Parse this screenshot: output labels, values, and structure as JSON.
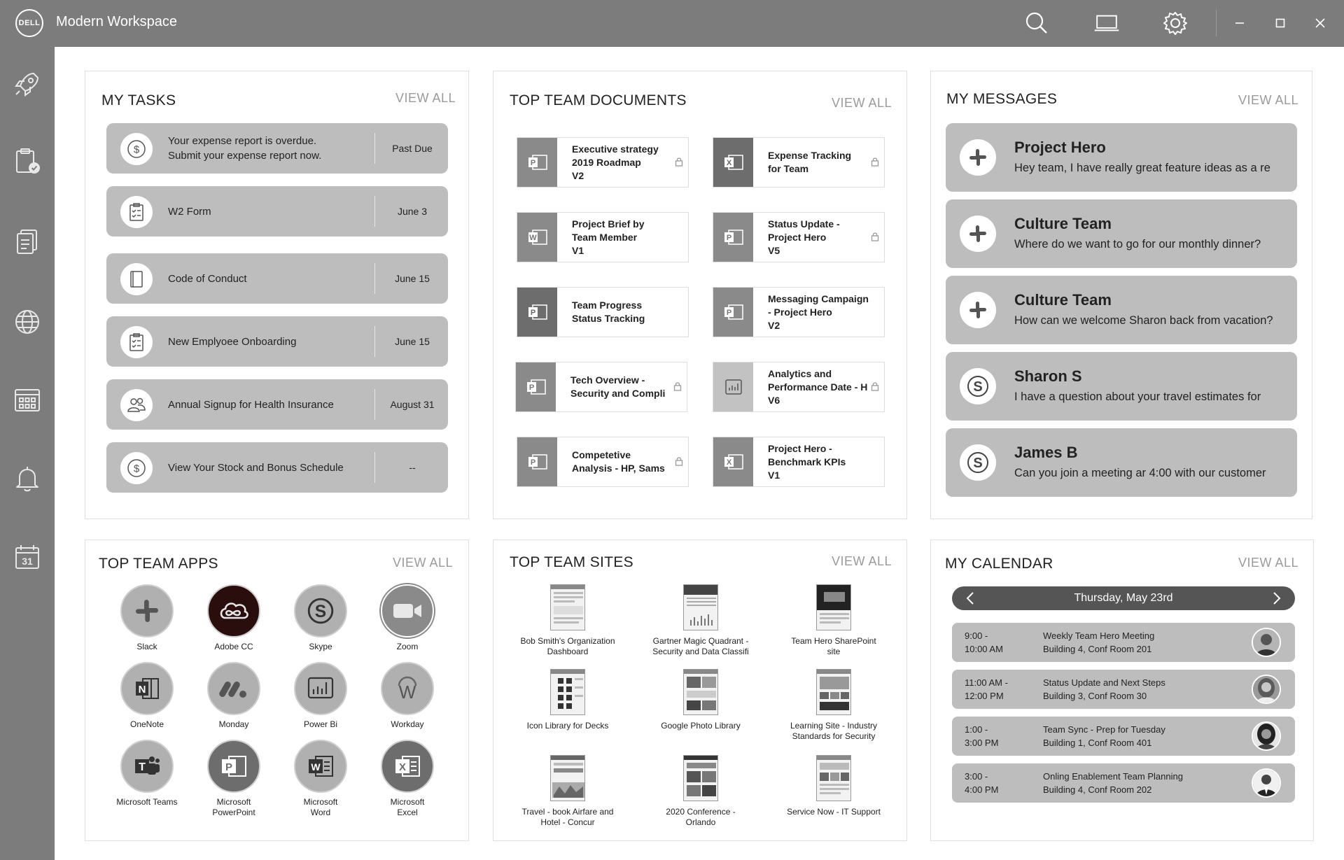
{
  "app": {
    "title": "Modern Workspace",
    "logo_text": "DELL"
  },
  "titlebar_icons": [
    "search-icon",
    "laptop-icon",
    "settings-icon",
    "minimize-icon",
    "maximize-icon",
    "close-icon"
  ],
  "sidebar_icons": [
    "rocket-icon",
    "clipboard-check-icon",
    "documents-icon",
    "globe-icon",
    "grid-calendar-icon",
    "bell-icon",
    "calendar-31-icon"
  ],
  "sidebar_calendar_day": "31",
  "tasks": {
    "title": "MY TASKS",
    "view_all": "VIEW ALL",
    "items": [
      {
        "text": "Your expense report is overdue.\nSubmit your expense report now.",
        "date": "Past Due",
        "icon": "dollar-icon"
      },
      {
        "text": "W2 Form",
        "date": "June 3",
        "icon": "checklist-icon"
      },
      {
        "text": "Code of Conduct",
        "date": "June 15",
        "icon": "book-icon"
      },
      {
        "text": "New Emplyoee Onboarding",
        "date": "June 15",
        "icon": "checklist-icon"
      },
      {
        "text": "Annual Signup for Health Insurance",
        "date": "August 31",
        "icon": "people-icon"
      },
      {
        "text": "View Your Stock and Bonus Schedule",
        "date": "--",
        "icon": "dollar-icon"
      }
    ]
  },
  "documents": {
    "title": "TOP TEAM DOCUMENTS",
    "view_all": "VIEW ALL",
    "items": [
      {
        "text": "Executive strategy\n2019 Roadmap\nV2",
        "type": "powerpoint",
        "locked": true
      },
      {
        "text": "Expense Tracking\nfor Team",
        "type": "excel",
        "locked": true
      },
      {
        "text": "Project Brief by\nTeam Member\nV1",
        "type": "word",
        "locked": false
      },
      {
        "text": "Status Update -\nProject Hero\nV5",
        "type": "powerpoint",
        "locked": true
      },
      {
        "text": "Team Progress\nStatus Tracking",
        "type": "powerpoint",
        "locked": false
      },
      {
        "text": "Messaging Campaign\n- Project Hero\nV2",
        "type": "powerpoint",
        "locked": false
      },
      {
        "text": "Tech Overview -\nSecurity and Compli",
        "type": "powerpoint",
        "locked": true
      },
      {
        "text": "Analytics and\nPerformance Date - H\nV6",
        "type": "powerbi",
        "locked": true
      },
      {
        "text": "Competetive\nAnalysis - HP, Sams",
        "type": "powerpoint",
        "locked": true
      },
      {
        "text": "Project Hero -\nBenchmark KPIs\nV1",
        "type": "excel",
        "locked": false
      }
    ]
  },
  "messages": {
    "title": "MY MESSAGES",
    "view_all": "VIEW ALL",
    "items": [
      {
        "name": "Project Hero",
        "body": "Hey team, I have really great feature ideas as a re",
        "icon": "slack-icon"
      },
      {
        "name": "Culture Team",
        "body": "Where do we want to go for our monthly dinner?",
        "icon": "slack-icon"
      },
      {
        "name": "Culture Team",
        "body": "How can we welcome Sharon back from vacation?",
        "icon": "slack-icon"
      },
      {
        "name": "Sharon S",
        "body": "I have a question about your travel estimates for",
        "icon": "skype-icon"
      },
      {
        "name": "James B",
        "body": "Can you join a meeting ar 4:00 with our customer",
        "icon": "skype-icon"
      }
    ]
  },
  "apps": {
    "title": "TOP TEAM APPS",
    "view_all": "VIEW ALL",
    "items": [
      {
        "label": "Slack",
        "icon": "slack-icon"
      },
      {
        "label": "Adobe CC",
        "icon": "adobe-cc-icon"
      },
      {
        "label": "Skype",
        "icon": "skype-icon"
      },
      {
        "label": "Zoom",
        "icon": "zoom-icon"
      },
      {
        "label": "OneNote",
        "icon": "onenote-icon"
      },
      {
        "label": "Monday",
        "icon": "monday-icon"
      },
      {
        "label": "Power Bi",
        "icon": "powerbi-icon"
      },
      {
        "label": "Workday",
        "icon": "workday-icon"
      },
      {
        "label": "Microsoft Teams",
        "icon": "teams-icon"
      },
      {
        "label": "Microsoft\nPowerPoint",
        "icon": "powerpoint-icon"
      },
      {
        "label": "Microsoft\nWord",
        "icon": "word-icon"
      },
      {
        "label": "Microsoft\nExcel",
        "icon": "excel-icon"
      }
    ]
  },
  "sites": {
    "title": "TOP TEAM SITES",
    "view_all": "VIEW ALL",
    "items": [
      {
        "label": "Bob Smith's Organization\nDashboard"
      },
      {
        "label": "Gartner Magic Quadrant -\nSecurity and Data Classifi"
      },
      {
        "label": "Team Hero SharePoint\nsite"
      },
      {
        "label": "Icon Library for Decks"
      },
      {
        "label": "Google Photo Library"
      },
      {
        "label": "Learning Site - Industry\nStandards for Security"
      },
      {
        "label": "Travel - book Airfare and\nHotel - Concur"
      },
      {
        "label": "2020 Conference -\nOrlando"
      },
      {
        "label": "Service Now - IT Support"
      }
    ]
  },
  "calendar": {
    "title": "MY CALENDAR",
    "view_all": "VIEW ALL",
    "date": "Thursday, May 23rd",
    "events": [
      {
        "time": "9:00 -\n10:00 AM",
        "title": "Weekly Team Hero Meeting",
        "location": "Building 4, Conf Room 201"
      },
      {
        "time": "11:00 AM -\n12:00 PM",
        "title": "Status Update and Next Steps",
        "location": "Building 3, Conf Room 30"
      },
      {
        "time": "1:00 -\n3:00 PM",
        "title": "Team Sync - Prep for Tuesday",
        "location": "Building 1, Conf Room 401"
      },
      {
        "time": "3:00 -\n4:00 PM",
        "title": "Onling Enablement Team Planning",
        "location": "Building 4, Conf Room 202"
      }
    ]
  }
}
